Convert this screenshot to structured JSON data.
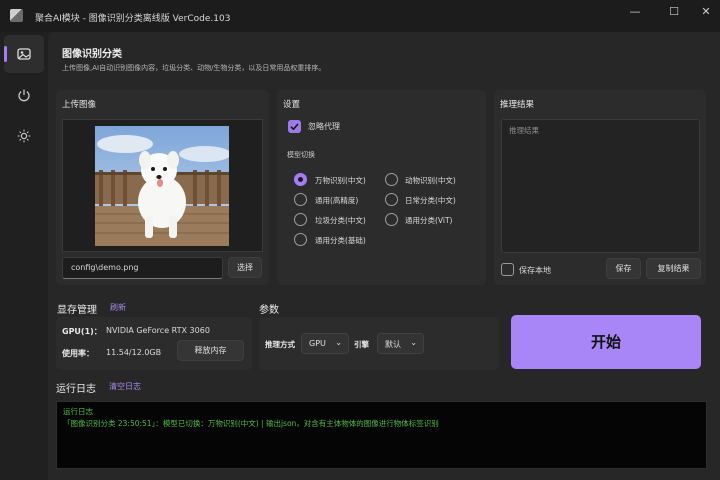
{
  "window": {
    "title": "聚合AI模块 - 图像识别分类离线版 VerCode.103",
    "minimize_glyph": "—",
    "maximize_glyph": "☐",
    "close_glyph": "✕"
  },
  "rail": {
    "items": [
      {
        "icon": "image-classify-icon",
        "active": true
      },
      {
        "icon": "power-icon",
        "active": false
      },
      {
        "icon": "brightness-icon",
        "active": false
      }
    ]
  },
  "header": {
    "title": "图像识别分类",
    "subtitle": "上传图像,AI自动识别图像内容，垃圾分类、动物/生物分类，以及日常用品权重排序。"
  },
  "upload": {
    "label": "上传图像",
    "path_value": "config\\demo.png",
    "select_button": "选择"
  },
  "settings": {
    "label": "设置",
    "ignore_proxy_label": "忽略代理",
    "ignore_proxy_checked": true,
    "model_switch_label": "模型切换",
    "models": [
      {
        "label": "万物识别(中文)",
        "selected": true
      },
      {
        "label": "动物识别(中文)",
        "selected": false
      },
      {
        "label": "通用(高精度)",
        "selected": false
      },
      {
        "label": "日常分类(中文)",
        "selected": false
      },
      {
        "label": "垃圾分类(中文)",
        "selected": false
      },
      {
        "label": "通用分类(ViT)",
        "selected": false
      },
      {
        "label": "通用分类(基础)",
        "selected": false
      }
    ]
  },
  "result": {
    "label": "推理结果",
    "placeholder": "推理结果",
    "save_local_label": "保存本地",
    "save_local_checked": false,
    "save_button": "保存",
    "copy_button": "复制结果"
  },
  "memory": {
    "title": "显存管理",
    "refresh_link": "刷新",
    "gpu_key": "GPU(1)：",
    "gpu_value": "NVIDIA GeForce RTX 3060",
    "usage_key": "使用率：",
    "usage_value": "11.54/12.0GB",
    "release_button": "释放内存"
  },
  "params": {
    "title": "参数",
    "infer_mode_label": "推理方式",
    "infer_mode_value": "GPU",
    "engine_label": "引擎",
    "engine_value": "默认"
  },
  "start_button": "开始",
  "log": {
    "title": "运行日志",
    "clear_link": "清空日志",
    "lines": [
      "运行日志",
      "「图像识别分类 23:50:51」：模型已切换：万物识别(中文) | 输出json，对含有主体物体的图像进行物体标签识别"
    ]
  },
  "colors": {
    "accent": "#a67cf5",
    "start_button": "#a886f7",
    "log_text": "#52b948",
    "background": "#202020",
    "card": "#2c2c2c"
  }
}
